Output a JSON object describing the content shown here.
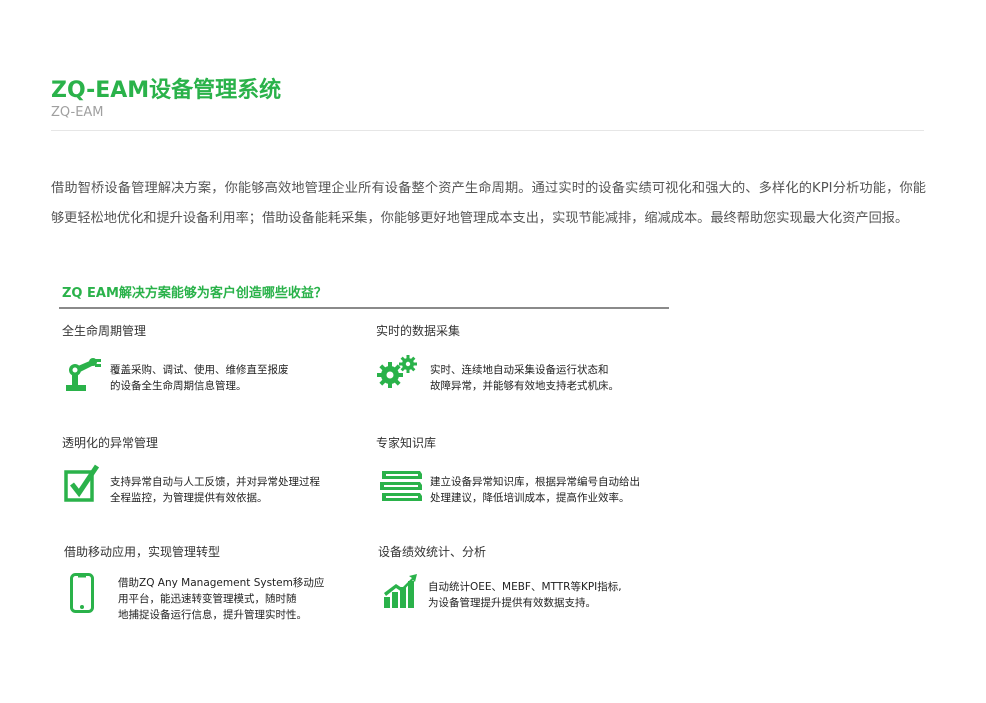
{
  "page": {
    "title": "ZQ-EAM设备管理系统",
    "subtitle": "ZQ-EAM",
    "intro": "借助智桥设备管理解决方案，你能够高效地管理企业所有设备整个资产生命周期。通过实时的设备实绩可视化和强大的、多样化的KPI分析功能，你能够更轻松地优化和提升设备利用率；借助设备能耗采集，你能够更好地管理成本支出，实现节能减排，缩减成本。最终帮助您实现最大化资产回报。"
  },
  "benefits": {
    "heading": "ZQ EAM解决方案能够为客户创造哪些收益？",
    "items": [
      {
        "title": "全生命周期管理",
        "icon": "robot-arm-icon",
        "lines": [
          "覆盖采购、调试、使用、维修直至报废",
          "的设备全生命周期信息管理。"
        ]
      },
      {
        "title": "实时的数据采集",
        "icon": "gears-icon",
        "lines": [
          "实时、连续地自动采集设备运行状态和",
          "故障异常，并能够有效地支持老式机床。"
        ]
      },
      {
        "title": "透明化的异常管理",
        "icon": "checkbox-icon",
        "lines": [
          "支持异常自动与人工反馈，并对异常处理过程",
          "全程监控，为管理提供有效依据。"
        ]
      },
      {
        "title": "专家知识库",
        "icon": "books-icon",
        "lines": [
          "建立设备异常知识库，根据异常编号自动给出",
          "处理建议，降低培训成本，提高作业效率。"
        ]
      },
      {
        "title": "借助移动应用，实现管理转型",
        "icon": "mobile-phone-icon",
        "lines": [
          "借助ZQ Any Management System移动应",
          "用平台，能迅速转变管理模式，随时随",
          "地捕捉设备运行信息，提升管理实时性。"
        ]
      },
      {
        "title": "设备绩效统计、分析",
        "icon": "bar-chart-icon",
        "lines": [
          "自动统计OEE、MEBF、MTTR等KPI指标,",
          "为设备管理提升提供有效数据支持。"
        ]
      }
    ]
  },
  "colors": {
    "accent": "#2ab24a",
    "text": "#555555"
  }
}
